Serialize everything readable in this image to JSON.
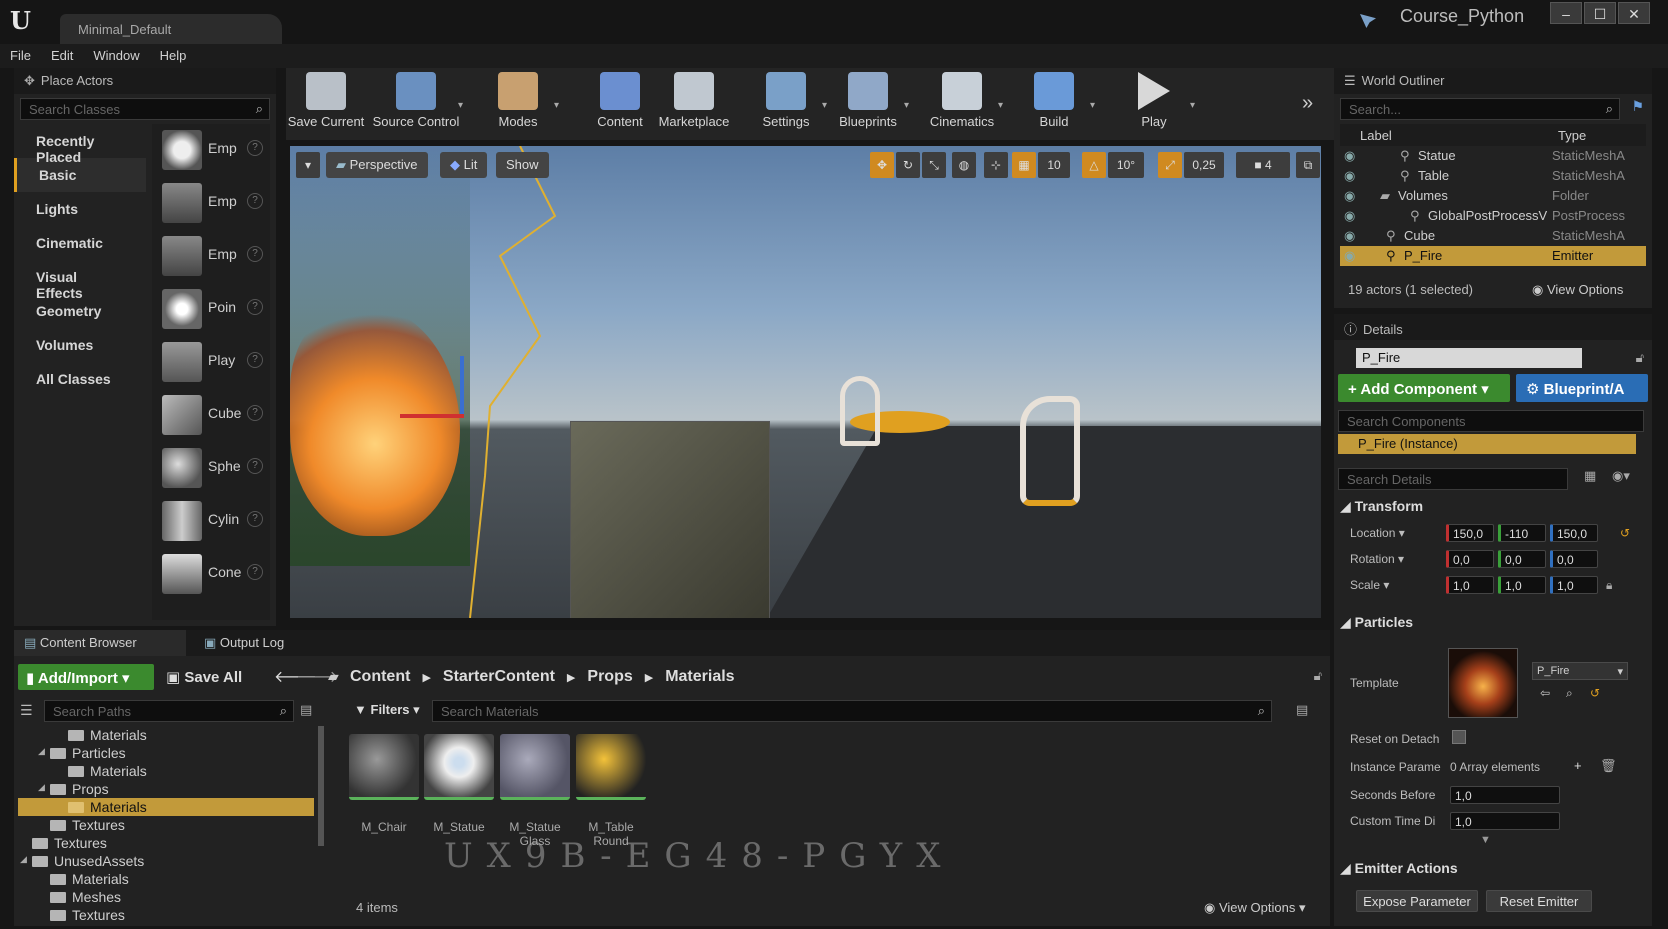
{
  "app": {
    "logo": "U",
    "doc_tab": "Minimal_Default",
    "project": "Course_Python"
  },
  "menu": [
    "File",
    "Edit",
    "Window",
    "Help"
  ],
  "place_actors": {
    "title": "Place Actors",
    "search_placeholder": "Search Classes",
    "categories": [
      "Recently Placed",
      "Basic",
      "Lights",
      "Cinematic",
      "Visual Effects",
      "Geometry",
      "Volumes",
      "All Classes"
    ],
    "selected_category": "Basic",
    "items": [
      "Emp",
      "Emp",
      "Emp",
      "Poin",
      "Play",
      "Cube",
      "Sphe",
      "Cylin",
      "Cone"
    ]
  },
  "toolbar": [
    "Save Current",
    "Source Control",
    "Modes",
    "Content",
    "Marketplace",
    "Settings",
    "Blueprints",
    "Cinematics",
    "Build",
    "Play"
  ],
  "viewport": {
    "perspective": "Perspective",
    "lit": "Lit",
    "show": "Show",
    "grid_snap": "10",
    "rot_snap": "10°",
    "scale_snap": "0,25",
    "cam_speed": "4"
  },
  "outliner": {
    "title": "World Outliner",
    "search_placeholder": "Search...",
    "col_label": "Label",
    "col_type": "Type",
    "rows": [
      {
        "label": "Statue",
        "type": "StaticMeshA"
      },
      {
        "label": "Table",
        "type": "StaticMeshA"
      },
      {
        "label": "Volumes",
        "type": "Folder"
      },
      {
        "label": "GlobalPostProcessV",
        "type": "PostProcess"
      },
      {
        "label": "Cube",
        "type": "StaticMeshA"
      },
      {
        "label": "P_Fire",
        "type": "Emitter"
      }
    ],
    "status": "19 actors (1 selected)",
    "view_options": "View Options"
  },
  "details": {
    "title": "Details",
    "name": "P_Fire",
    "add_component": "Add Component",
    "blueprint": "Blueprint/A",
    "search_components": "Search Components",
    "instance": "P_Fire (Instance)",
    "search_details": "Search Details",
    "transform_header": "Transform",
    "location_label": "Location",
    "rotation_label": "Rotation",
    "scale_label": "Scale",
    "location": [
      "150,0",
      "-110",
      "150,0"
    ],
    "rotation": [
      "0,0",
      "0,0",
      "0,0"
    ],
    "scale": [
      "1,0",
      "1,0",
      "1,0"
    ],
    "particles_header": "Particles",
    "template_label": "Template",
    "template_value": "P_Fire",
    "reset_on_detach": "Reset on Detach",
    "instance_params": "Instance Parame",
    "array_elements": "0 Array elements",
    "seconds_before": "Seconds Before",
    "seconds_value": "1,0",
    "custom_time": "Custom Time Di",
    "custom_value": "1,0",
    "emitter_actions": "Emitter Actions",
    "expose_param": "Expose Parameter",
    "reset_emitter": "Reset Emitter"
  },
  "content_browser": {
    "tab": "Content Browser",
    "output_tab": "Output Log",
    "add_import": "Add/Import",
    "save_all": "Save All",
    "path": [
      "Content",
      "StarterContent",
      "Props",
      "Materials"
    ],
    "search_paths": "Search Paths",
    "filters": "Filters",
    "search_materials": "Search Materials",
    "tree": [
      {
        "label": "Materials",
        "indent": 2
      },
      {
        "label": "Particles",
        "indent": 1
      },
      {
        "label": "Materials",
        "indent": 2
      },
      {
        "label": "Props",
        "indent": 1
      },
      {
        "label": "Materials",
        "indent": 2
      },
      {
        "label": "Textures",
        "indent": 1
      },
      {
        "label": "Textures",
        "indent": 0
      },
      {
        "label": "UnusedAssets",
        "indent": 0
      },
      {
        "label": "Materials",
        "indent": 1
      },
      {
        "label": "Meshes",
        "indent": 1
      },
      {
        "label": "Textures",
        "indent": 1
      }
    ],
    "selected_tree_index": 4,
    "materials": [
      "M_Chair",
      "M_Statue",
      "M_Statue Glass",
      "M_Table Round"
    ],
    "count": "4 items",
    "view_options": "View Options",
    "watermark": "UX9B-EG48-PGYX"
  }
}
